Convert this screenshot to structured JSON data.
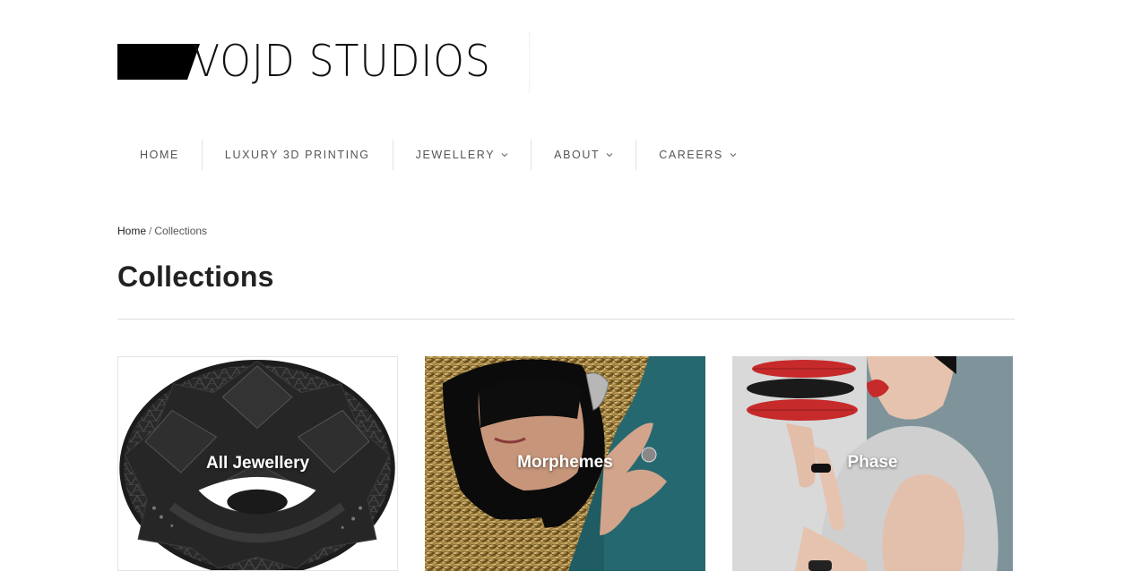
{
  "brand": {
    "name": "VOJD STUDIOS"
  },
  "nav": [
    {
      "label": "HOME",
      "has_dropdown": false
    },
    {
      "label": "LUXURY 3D PRINTING",
      "has_dropdown": false
    },
    {
      "label": "JEWELLERY",
      "has_dropdown": true
    },
    {
      "label": "ABOUT",
      "has_dropdown": true
    },
    {
      "label": "CAREERS",
      "has_dropdown": true
    }
  ],
  "breadcrumb": {
    "home": "Home",
    "separator": "/",
    "current": "Collections"
  },
  "page": {
    "title": "Collections"
  },
  "collections": [
    {
      "title": "All Jewellery",
      "image": "black 3d-printed geometric ornament"
    },
    {
      "title": "Morphemes",
      "image": "model in gold hooded jacket with ear cuff"
    },
    {
      "title": "Phase",
      "image": "model in grey top with red bracelets"
    }
  ],
  "colors": {
    "accent": "#111111",
    "text": "#222222",
    "nav_text": "#555555",
    "rule": "#dcdcdc",
    "red": "#c62a2a"
  },
  "icons": {
    "nav_dropdown": "chevron-down-icon"
  }
}
